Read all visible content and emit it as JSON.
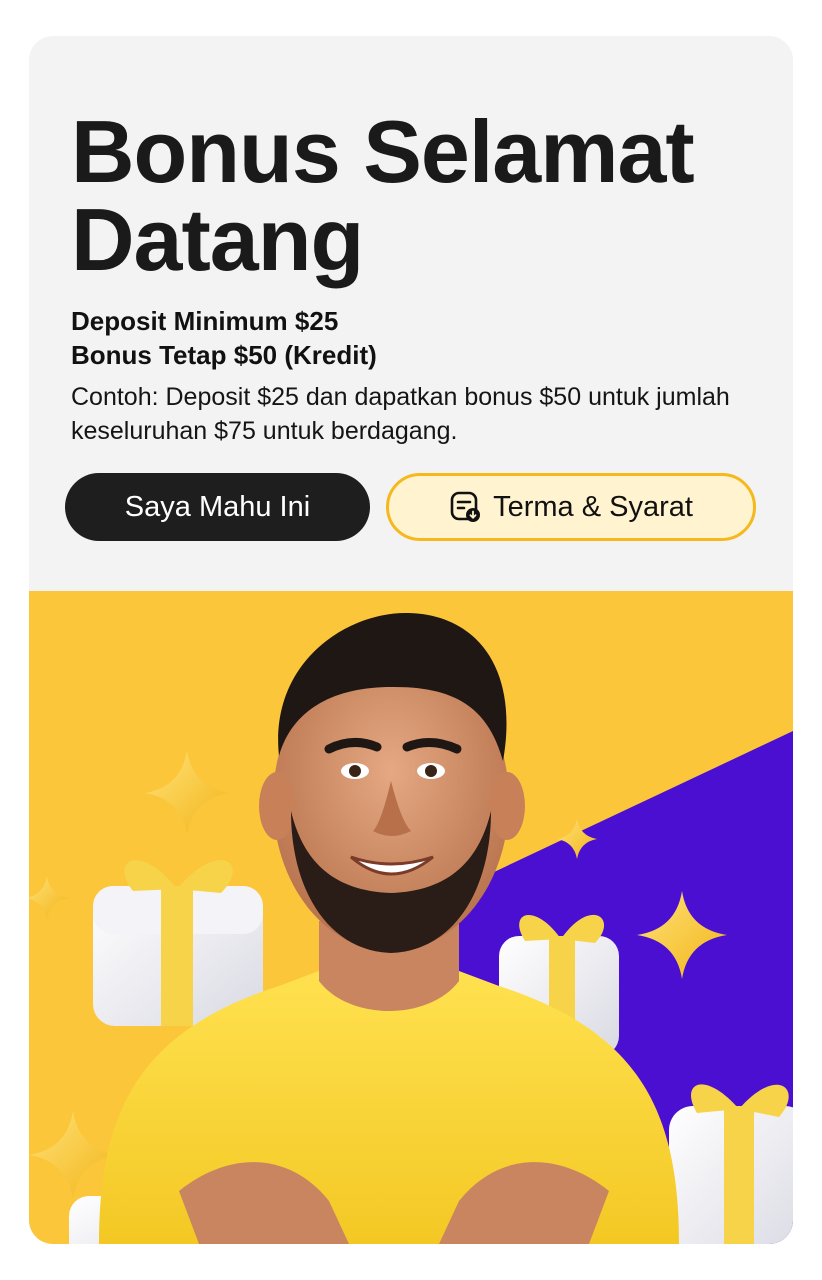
{
  "promo": {
    "title": "Bonus Selamat\nDatang",
    "min_deposit": "Deposit Minimum $25",
    "fixed_bonus": "Bonus Tetap $50 (Kredit)",
    "example": "Contoh: Deposit $25 dan dapatkan bonus $50 untuk jumlah keseluruhan $75 untuk berdagang."
  },
  "buttons": {
    "primary_label": "Saya Mahu Ini",
    "terms_label": "Terma & Syarat",
    "terms_icon": "document-download-icon"
  },
  "colors": {
    "card_bg": "#f3f3f3",
    "hero_yellow": "#fcc63a",
    "hero_purple": "#4a0fd0",
    "primary_button": "#1e1e1e",
    "terms_border": "#f5b91e",
    "terms_fill": "#fff4cf"
  }
}
